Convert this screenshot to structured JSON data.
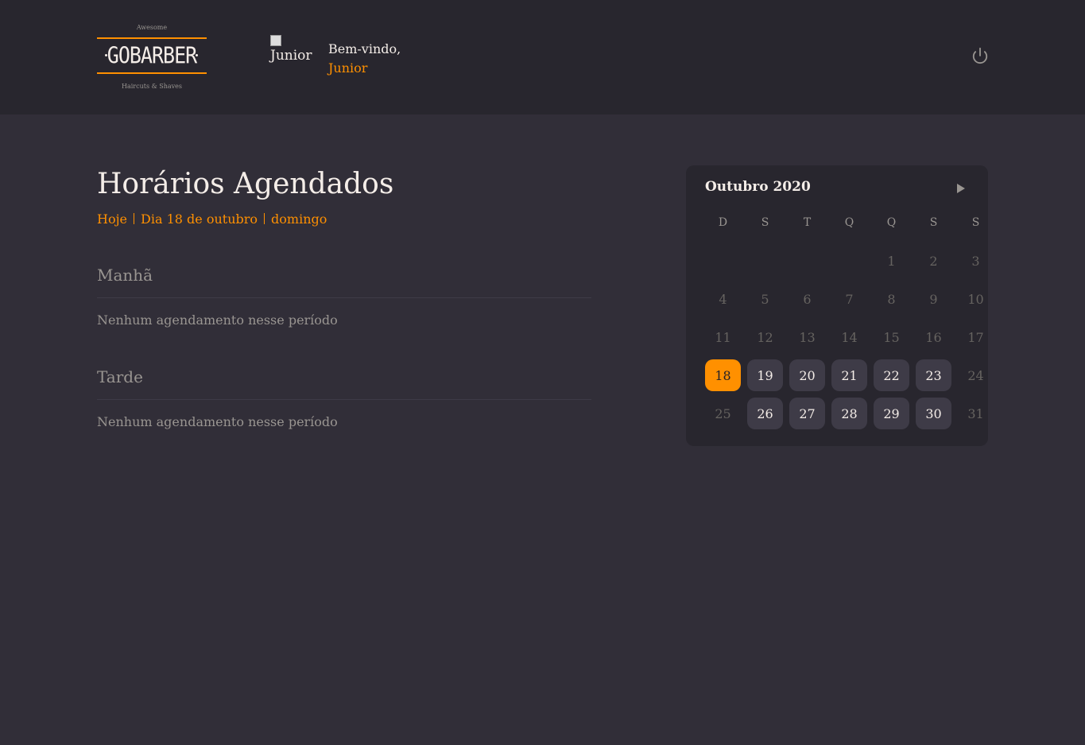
{
  "header": {
    "logo": {
      "top_text": "Awesome",
      "name": "GOBARBER",
      "bottom_text": "Haircuts & Shaves"
    },
    "avatar_alt": "Junior",
    "welcome_label": "Bem-vindo,",
    "user_name": "Junior",
    "power_icon": "power-icon"
  },
  "schedule": {
    "title": "Horários Agendados",
    "meta": {
      "today": "Hoje",
      "date": "Dia 18 de outubro",
      "weekday": "domingo"
    },
    "sections": [
      {
        "title": "Manhã",
        "empty_text": "Nenhum agendamento nesse período"
      },
      {
        "title": "Tarde",
        "empty_text": "Nenhum agendamento nesse período"
      }
    ]
  },
  "calendar": {
    "month_title": "Outubro 2020",
    "next_icon": "triangle-right-icon",
    "weekdays": [
      "D",
      "S",
      "T",
      "Q",
      "Q",
      "S",
      "S"
    ],
    "first_weekday_index": 4,
    "days_in_month": 31,
    "selected_day": 18,
    "available_days": [
      19,
      20,
      21,
      22,
      23,
      26,
      27,
      28,
      29,
      30
    ]
  },
  "colors": {
    "accent": "#ff9000",
    "background": "#312e38",
    "panel": "#28262e",
    "muted": "#999591",
    "day_available": "#3e3b47",
    "day_disabled": "#666360"
  }
}
